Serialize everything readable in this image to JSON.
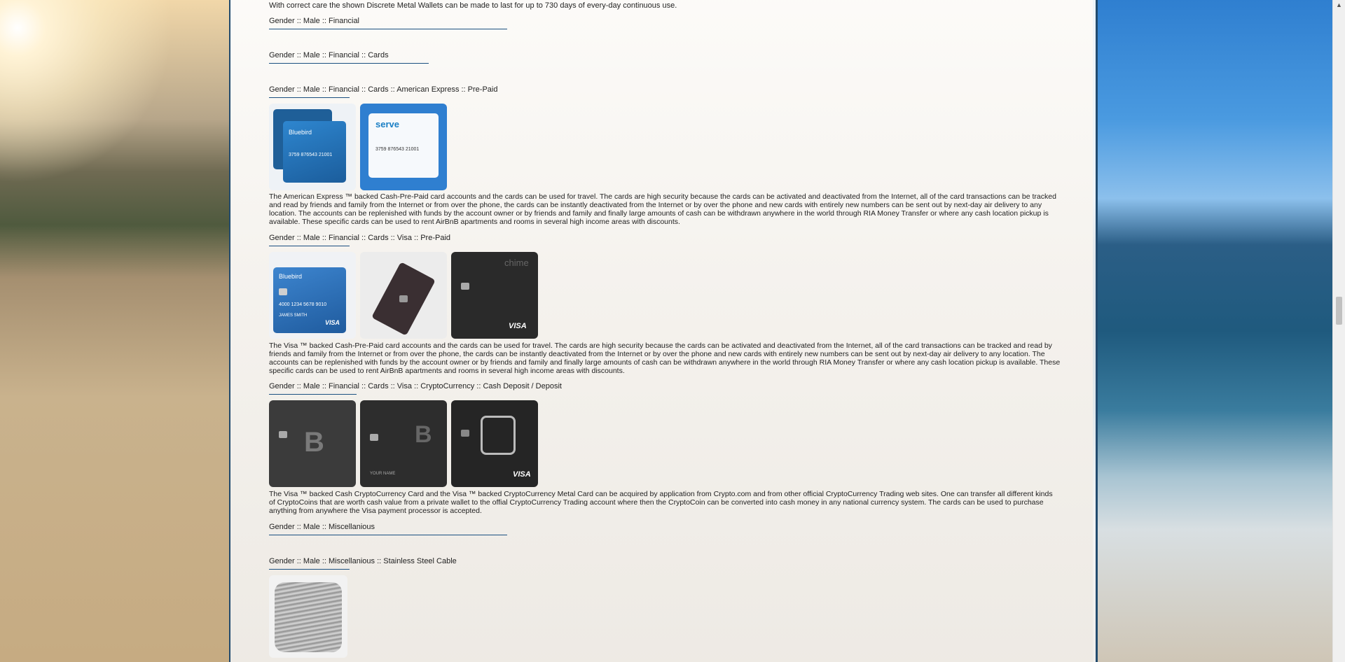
{
  "intro_text": "With correct care the shown Discrete Metal Wallets can be made to last for up to 730 days of every-day continuous use.",
  "sections": {
    "financial": {
      "title": "Gender :: Male :: Financial"
    },
    "cards": {
      "title": "Gender :: Male :: Financial :: Cards"
    },
    "amex": {
      "title": "Gender :: Male :: Financial :: Cards :: American Express :: Pre-Paid",
      "description": "The American Express ™ backed Cash-Pre-Paid card accounts and the cards can be used for travel. The cards are high security because the cards can be activated and deactivated from the Internet, all of the card transactions can be tracked and read by friends and family from the Internet or from over the phone, the cards can be instantly deactivated from the Internet or by over the phone and new cards with entirely new numbers can be sent out by next-day air delivery to any location. The accounts can be replenished with funds by the account owner or by friends and family and finally large amounts of cash can be withdrawn anywhere in the world through RIA Money Transfer or where any cash location pickup is available. These specific cards can be used to rent AirBnB apartments and rooms in several high income areas with discounts.",
      "images": [
        {
          "icon": "bluebird-amex-card-image",
          "brand": "Bluebird",
          "number": "3759 876543 21001"
        },
        {
          "icon": "serve-amex-card-image",
          "brand": "serve",
          "number": "3759 876543 21001"
        }
      ]
    },
    "visa": {
      "title": "Gender :: Male :: Financial :: Cards :: Visa :: Pre-Paid",
      "description": "The Visa ™ backed Cash-Pre-Paid card accounts and the cards can be used for travel. The cards are high security because the cards can be activated and deactivated from the Internet, all of the card transactions can be tracked and read by friends and family from the Internet or from over the phone, the cards can be instantly deactivated from the Internet or by over the phone and new cards with entirely new numbers can be sent out by next-day air delivery to any location. The accounts can be replenished with funds by the account owner or by friends and family and finally large amounts of cash can be withdrawn anywhere in the world through RIA Money Transfer or where any cash location pickup is available. These specific cards can be used to rent AirBnB apartments and rooms in several high income areas with discounts.",
      "images": [
        {
          "icon": "bluebird-visa-card-image",
          "brand": "Bluebird",
          "number": "4000 1234 5678 9010",
          "name": "JAMES SMITH",
          "network": "VISA"
        },
        {
          "icon": "dark-metal-card-image"
        },
        {
          "icon": "chime-visa-card-image",
          "brand": "chime",
          "network": "VISA"
        }
      ]
    },
    "crypto": {
      "title": "Gender :: Male :: Financial :: Cards :: Visa :: CryptoCurrency :: Cash Deposit / Deposit",
      "description": "The Visa ™ backed Cash CryptoCurrency Card and the Visa ™ backed CryptoCurrency Metal Card can be acquired by application from Crypto.com and from other official CryptoCurrency Trading web sites. One can transfer all different kinds of CryptoCoins that are worth cash value from a private wallet to the offial CryptoCurrency Trading account where then the CryptoCoin can be converted into cash money in any national currency system. The cards can be used to purchase anything from anywhere the Visa payment processor is accepted.",
      "images": [
        {
          "icon": "bitcoin-card-image",
          "symbol": "B"
        },
        {
          "icon": "bitcoin-circuit-card-image",
          "symbol": "B",
          "name": "YOUR NAME"
        },
        {
          "icon": "crypto-com-visa-card-image",
          "network": "VISA"
        }
      ]
    },
    "misc": {
      "title": "Gender :: Male :: Miscellanious"
    },
    "cable": {
      "title": "Gender :: Male :: Miscellanious :: Stainless Steel Cable",
      "images": [
        {
          "icon": "steel-cable-spool-image"
        }
      ]
    }
  },
  "colors": {
    "accent_line": "#1a4f80",
    "frame_border": "#224b6e"
  }
}
